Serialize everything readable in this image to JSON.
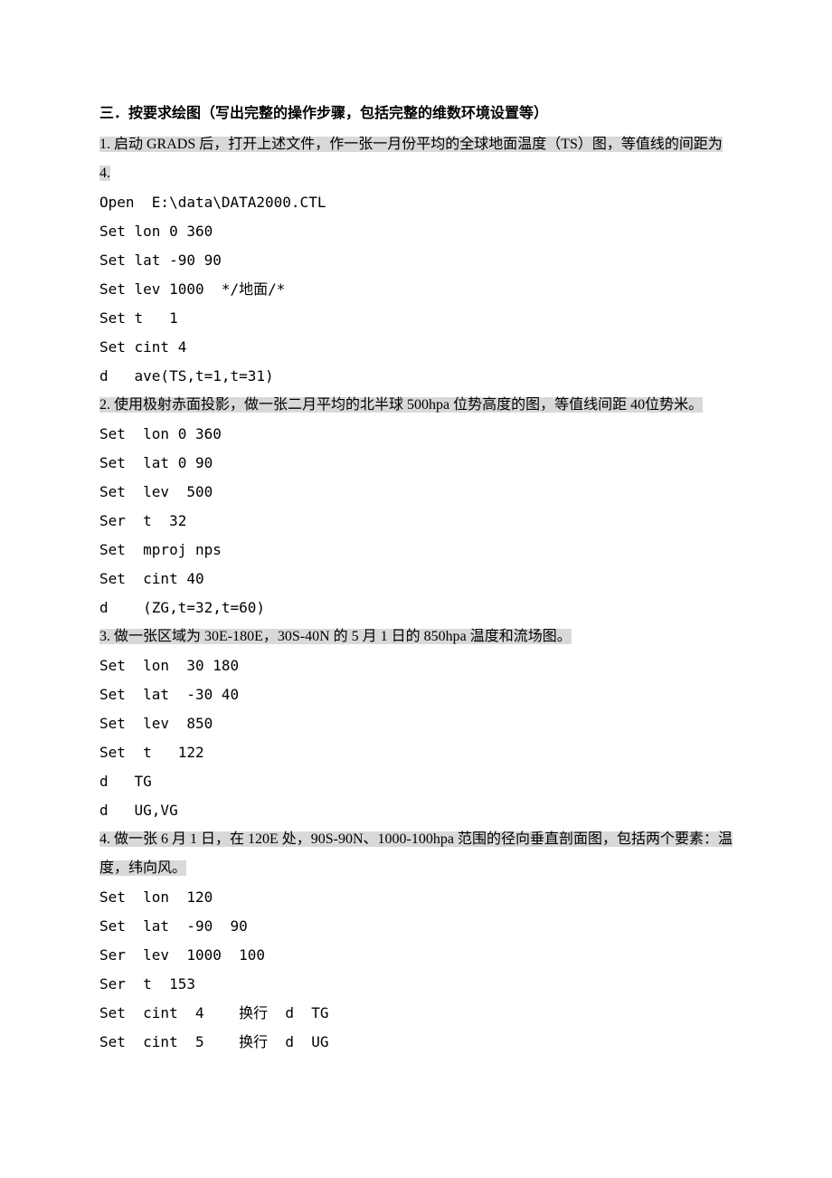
{
  "heading": "三．按要求绘图（写出完整的操作步骤，包括完整的维数环境设置等）",
  "sections": [
    {
      "question": "1. 启动 GRADS 后，打开上述文件，作一张一月份平均的全球地面温度（TS）图，等值线的间距为 4.",
      "answers": [
        "Open  E:\\data\\DATA2000.CTL",
        "Set lon 0 360",
        "Set lat -90 90",
        "Set lev 1000  */地面/*",
        "Set t   1",
        "Set cint 4",
        "d   ave(TS,t=1,t=31)"
      ]
    },
    {
      "question": "2. 使用极射赤面投影，做一张二月平均的北半球 500hpa 位势高度的图，等值线间距 40位势米。",
      "answers": [
        "Set  lon 0 360",
        "Set  lat 0 90",
        "Set  lev  500",
        "Ser  t  32",
        "Set  mproj nps",
        "Set  cint 40",
        "d    (ZG,t=32,t=60)"
      ]
    },
    {
      "question": "3. 做一张区域为 30E-180E，30S-40N 的 5 月 1 日的 850hpa 温度和流场图。",
      "answers": [
        "Set  lon  30 180",
        "Set  lat  -30 40",
        "Set  lev  850",
        "Set  t   122",
        "d   TG",
        "d   UG,VG"
      ]
    },
    {
      "question": "4. 做一张 6 月 1 日，在 120E 处，90S-90N、1000-100hpa 范围的径向垂直剖面图，包括两个要素：温度，纬向风。",
      "answers": [
        "Set  lon  120",
        "Set  lat  -90  90",
        "Ser  lev  1000  100",
        "Ser  t  153",
        "Set  cint  4    换行  d  TG",
        "Set  cint  5    换行  d  UG"
      ]
    }
  ]
}
